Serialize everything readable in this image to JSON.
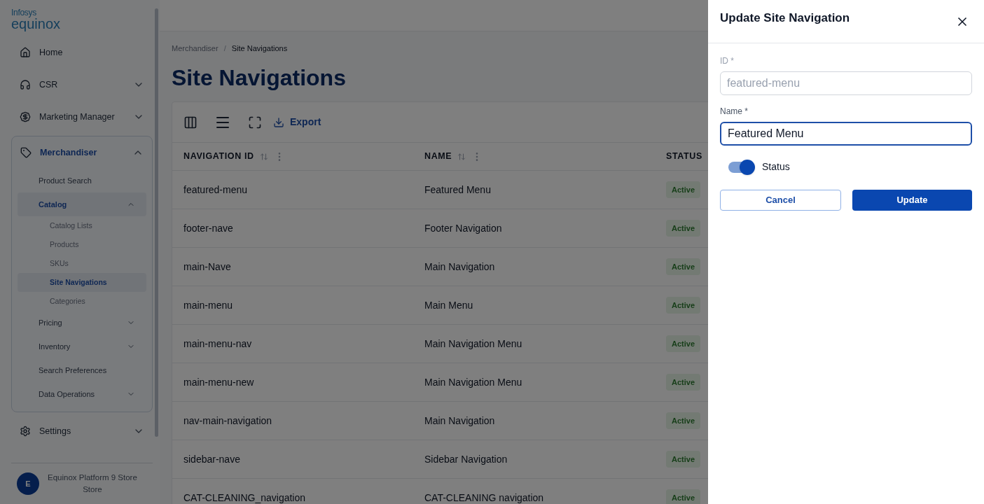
{
  "sidebar": {
    "logo_top": "Infosys",
    "logo_bottom": "equinox",
    "items": [
      {
        "label": "Home",
        "selected": false
      },
      {
        "label": "CSR",
        "selected": false,
        "expanded": false
      },
      {
        "label": "Marketing Manager",
        "selected": false,
        "expanded": false
      },
      {
        "label": "Merchandiser",
        "selected": true,
        "expanded": true,
        "children": [
          {
            "label": "Product Search",
            "selected": false
          },
          {
            "label": "Catalog",
            "selected": true,
            "expanded": true,
            "children": [
              {
                "label": "Catalog Lists",
                "selected": false
              },
              {
                "label": "Products",
                "selected": false
              },
              {
                "label": "SKUs",
                "selected": false
              },
              {
                "label": "Site Navigations",
                "selected": true
              },
              {
                "label": "Categories",
                "selected": false
              }
            ]
          },
          {
            "label": "Pricing",
            "selected": false,
            "expanded": false
          },
          {
            "label": "Inventory",
            "selected": false,
            "expanded": false
          },
          {
            "label": "Search Preferences",
            "selected": false
          },
          {
            "label": "Data Operations",
            "selected": false,
            "expanded": false
          }
        ]
      },
      {
        "label": "Settings",
        "selected": false,
        "expanded": false
      }
    ],
    "user": {
      "initial": "E",
      "name": "Equinox Platform 9 Store",
      "role": "Store"
    }
  },
  "breadcrumb": {
    "items": [
      "Merchandiser",
      "Site Navigations"
    ],
    "separator": "/"
  },
  "title": "Site Navigations",
  "toolbar": {
    "export": "Export"
  },
  "table": {
    "columns": [
      "NAVIGATION ID",
      "NAME",
      "STATUS"
    ],
    "rows": [
      {
        "id": "featured-menu",
        "name": "Featured Menu",
        "status": "Active"
      },
      {
        "id": "footer-nave",
        "name": "Footer Navigation",
        "status": "Active"
      },
      {
        "id": "main-Nave",
        "name": "Main Navigation",
        "status": "Active"
      },
      {
        "id": "main-menu",
        "name": "Main Menu",
        "status": "Active"
      },
      {
        "id": "main-menu-nav",
        "name": "Main Navigation Menu",
        "status": "Active"
      },
      {
        "id": "main-menu-new",
        "name": "Main Navigation Menu",
        "status": "Active"
      },
      {
        "id": "nav-main-navigation",
        "name": "Main Navigation",
        "status": "Active"
      },
      {
        "id": "sidebar-nave",
        "name": "Sidebar Navigation",
        "status": "Active"
      },
      {
        "id": "CAT-CLEANING_navigation",
        "name": "CAT-CLEANING navigation",
        "status": "Active"
      }
    ]
  },
  "drawer": {
    "title": "Update Site Navigation",
    "fields": [
      {
        "label": "ID *",
        "value": "featured-menu",
        "disabled": true,
        "focused": false
      },
      {
        "label": "Name *",
        "value": "Featured Menu",
        "disabled": false,
        "focused": true
      }
    ],
    "status": {
      "label": "Status",
      "on": true
    },
    "buttons": [
      {
        "label": "Cancel",
        "kind": "secondary"
      },
      {
        "label": "Update",
        "kind": "primary"
      }
    ]
  }
}
